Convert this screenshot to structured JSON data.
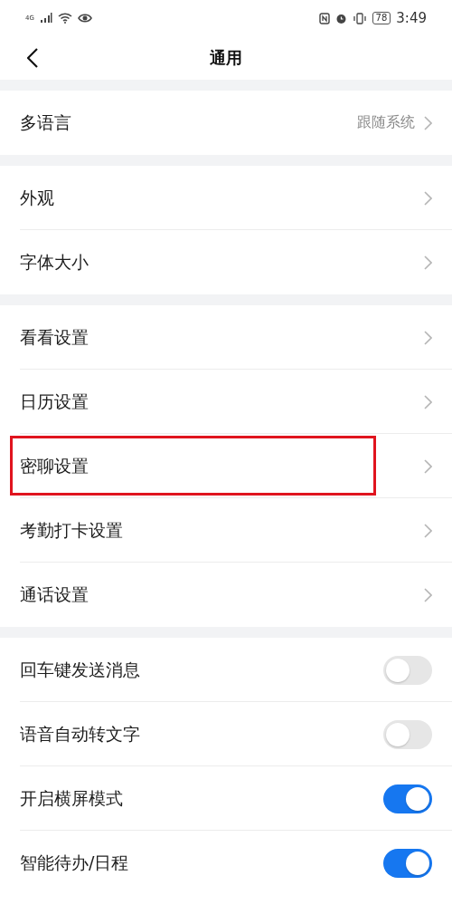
{
  "status_bar": {
    "network": "4G",
    "battery": "78",
    "time": "3:49"
  },
  "header": {
    "title": "通用"
  },
  "sections": [
    [
      {
        "kind": "link",
        "label": "多语言",
        "value": "跟随系统",
        "highlighted": false
      }
    ],
    [
      {
        "kind": "link",
        "label": "外观",
        "highlighted": false
      },
      {
        "kind": "link",
        "label": "字体大小",
        "highlighted": false
      }
    ],
    [
      {
        "kind": "link",
        "label": "看看设置",
        "highlighted": false
      },
      {
        "kind": "link",
        "label": "日历设置",
        "highlighted": false
      },
      {
        "kind": "link",
        "label": "密聊设置",
        "highlighted": true
      },
      {
        "kind": "link",
        "label": "考勤打卡设置",
        "highlighted": false
      },
      {
        "kind": "link",
        "label": "通话设置",
        "highlighted": false
      }
    ],
    [
      {
        "kind": "toggle",
        "label": "回车键发送消息",
        "on": false,
        "highlighted": false
      },
      {
        "kind": "toggle",
        "label": "语音自动转文字",
        "on": false,
        "highlighted": false
      },
      {
        "kind": "toggle",
        "label": "开启横屏模式",
        "on": true,
        "highlighted": false
      },
      {
        "kind": "toggle",
        "label": "智能待办/日程",
        "on": true,
        "highlighted": false
      }
    ]
  ]
}
